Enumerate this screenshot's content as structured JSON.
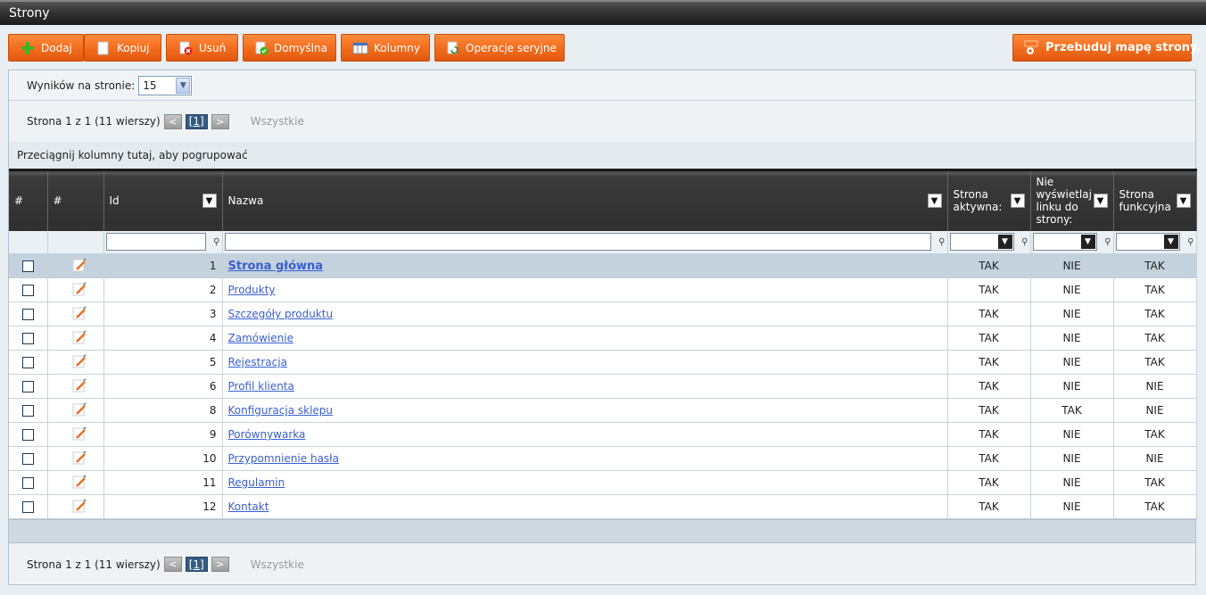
{
  "window": {
    "title": "Strony"
  },
  "toolbar": {
    "add": "Dodaj",
    "copy": "Kopiuj",
    "delete": "Usuń",
    "default": "Domyślna",
    "columns": "Kolumny",
    "batch": "Operacje seryjne",
    "rebuild": "Przebuduj mapę strony.",
    "accent": "#f26b1d"
  },
  "perpage": {
    "label": "Wyników na stronie:",
    "value": "15"
  },
  "pager": {
    "info": "Strona 1 z 1 (11 wierszy)",
    "current": "[1]",
    "prev": "<",
    "next": ">",
    "all": "Wszystkie"
  },
  "group_hint": "Przeciągnij kolumny tutaj, aby pogrupować",
  "columns": {
    "sel": "#",
    "edit": "#",
    "id": "Id",
    "name": "Nazwa",
    "active": "Strona aktywna:",
    "hide": "Nie wyświetlaj linku do strony:",
    "functional": "Strona funkcyjna"
  },
  "rows": [
    {
      "id": "1",
      "name": "Strona główna",
      "active": "TAK",
      "hide": "NIE",
      "functional": "TAK"
    },
    {
      "id": "2",
      "name": "Produkty",
      "active": "TAK",
      "hide": "NIE",
      "functional": "TAK"
    },
    {
      "id": "3",
      "name": "Szczegóły produktu",
      "active": "TAK",
      "hide": "NIE",
      "functional": "TAK"
    },
    {
      "id": "4",
      "name": "Zamówienie",
      "active": "TAK",
      "hide": "NIE",
      "functional": "TAK"
    },
    {
      "id": "5",
      "name": "Rejestracja",
      "active": "TAK",
      "hide": "NIE",
      "functional": "TAK"
    },
    {
      "id": "6",
      "name": "Profil klienta",
      "active": "TAK",
      "hide": "NIE",
      "functional": "NIE"
    },
    {
      "id": "8",
      "name": "Konfiguracja sklepu",
      "active": "TAK",
      "hide": "TAK",
      "functional": "NIE"
    },
    {
      "id": "9",
      "name": "Porównywarka",
      "active": "TAK",
      "hide": "NIE",
      "functional": "TAK"
    },
    {
      "id": "10",
      "name": "Przypomnienie hasła",
      "active": "TAK",
      "hide": "NIE",
      "functional": "NIE"
    },
    {
      "id": "11",
      "name": "Regulamin",
      "active": "TAK",
      "hide": "NIE",
      "functional": "TAK"
    },
    {
      "id": "12",
      "name": "Kontakt",
      "active": "TAK",
      "hide": "NIE",
      "functional": "TAK"
    }
  ]
}
